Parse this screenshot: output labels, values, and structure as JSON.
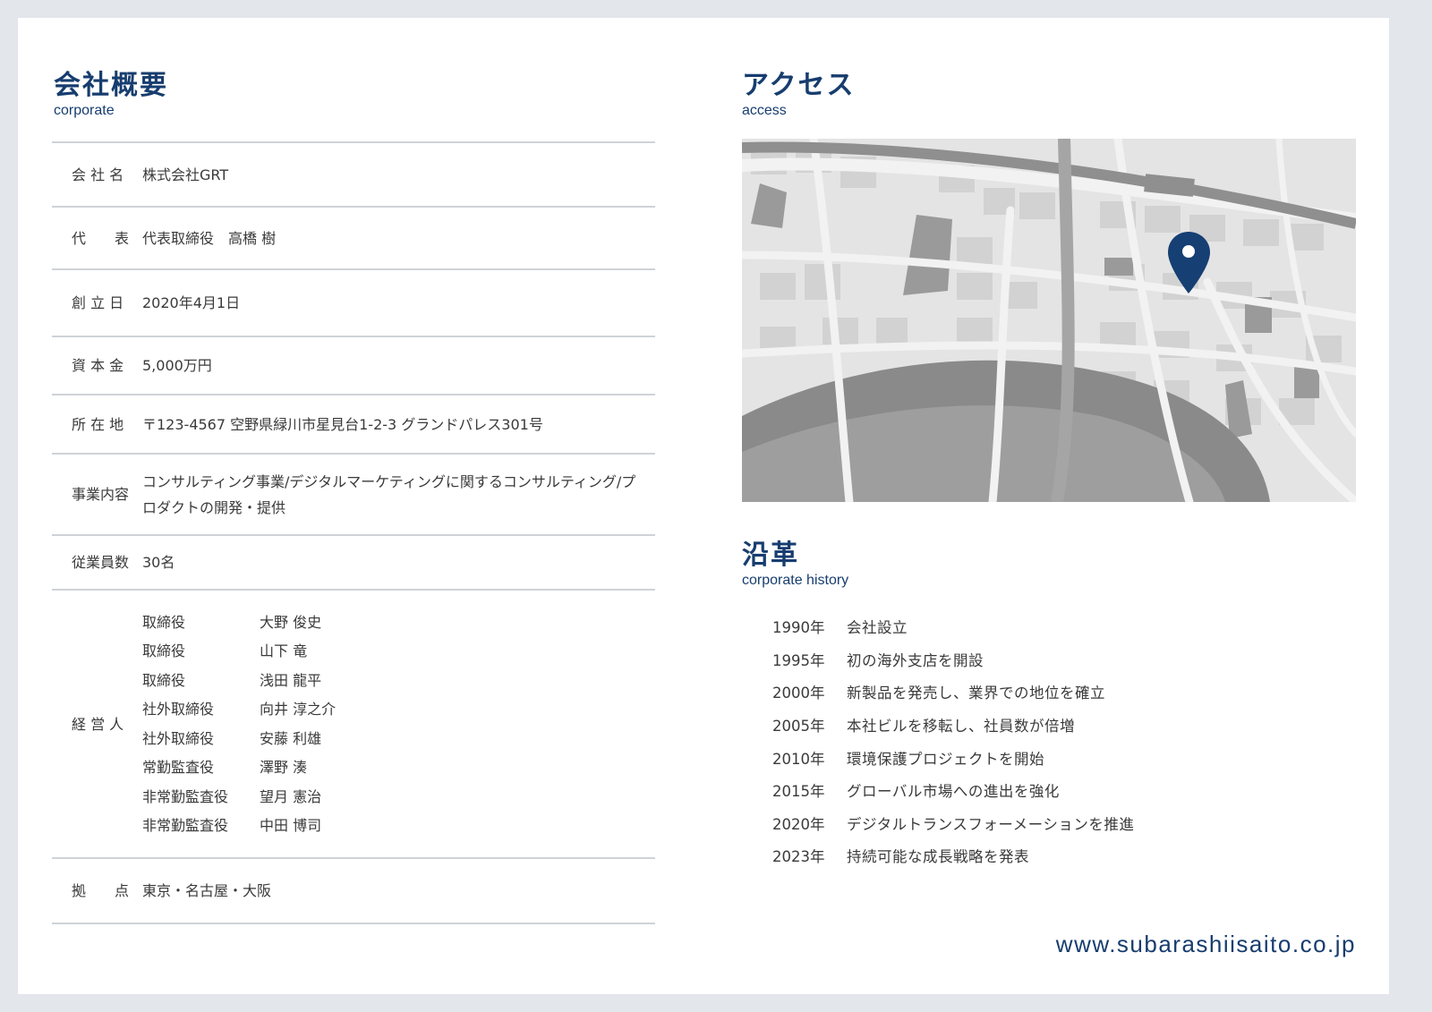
{
  "corporate": {
    "title": "会社概要",
    "subtitle": "corporate",
    "rows": [
      {
        "label": "会 社 名",
        "value": "株式会社GRT"
      },
      {
        "label": "代　　表",
        "value": "代表取締役　高橋 樹"
      },
      {
        "label": "創 立 日",
        "value": "2020年4月1日"
      },
      {
        "label": "資 本 金",
        "value": "5,000万円"
      },
      {
        "label": "所 在 地",
        "value": "〒123-4567 空野県緑川市星見台1-2-3 グランドパレス301号"
      },
      {
        "label": "事業内容",
        "value": "コンサルティング事業/デジタルマーケティングに関するコンサルティング/プロダクトの開発・提供"
      },
      {
        "label": "従業員数",
        "value": "30名"
      }
    ],
    "officers_label": "経 営 人",
    "officers": [
      {
        "role": "取締役",
        "name": "大野 俊史"
      },
      {
        "role": "取締役",
        "name": "山下 竜"
      },
      {
        "role": "取締役",
        "name": "浅田 龍平"
      },
      {
        "role": "社外取締役",
        "name": "向井 淳之介"
      },
      {
        "role": "社外取締役",
        "name": "安藤 利雄"
      },
      {
        "role": "常勤監査役",
        "name": "澤野 湊"
      },
      {
        "role": "非常勤監査役",
        "name": "望月 憲治"
      },
      {
        "role": "非常勤監査役",
        "name": "中田 博司"
      }
    ],
    "offices_label": "拠　　点",
    "offices_value": "東京・名古屋・大阪"
  },
  "access": {
    "title": "アクセス",
    "subtitle": "access",
    "map_pin_color": "#163f73"
  },
  "history": {
    "title": "沿革",
    "subtitle": "corporate history",
    "items": [
      {
        "year": "1990年",
        "event": "会社設立"
      },
      {
        "year": "1995年",
        "event": "初の海外支店を開設"
      },
      {
        "year": "2000年",
        "event": "新製品を発売し、業界での地位を確立"
      },
      {
        "year": "2005年",
        "event": "本社ビルを移転し、社員数が倍増"
      },
      {
        "year": "2010年",
        "event": "環境保護プロジェクトを開始"
      },
      {
        "year": "2015年",
        "event": "グローバル市場への進出を強化"
      },
      {
        "year": "2020年",
        "event": "デジタルトランスフォーメーションを推進"
      },
      {
        "year": "2023年",
        "event": "持続可能な成長戦略を発表"
      }
    ]
  },
  "footer": {
    "url": "www.subarashiisaito.co.jp"
  },
  "colors": {
    "accent": "#173d6f",
    "background": "#e3e6eb",
    "divider": "#cfd3d8"
  }
}
